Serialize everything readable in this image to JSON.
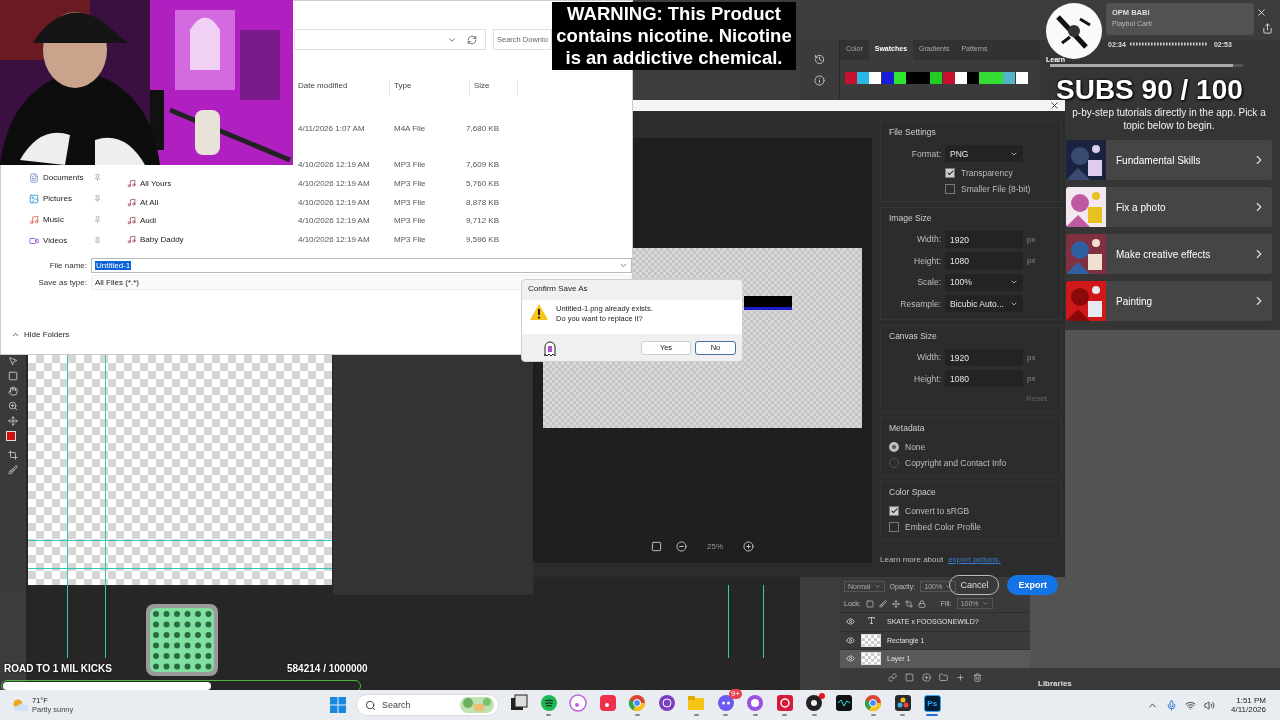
{
  "file_dialog": {
    "search_placeholder": "Search Downlo",
    "columns": [
      "Date modified",
      "Type",
      "Size"
    ],
    "files": [
      {
        "date": "4/11/2026 1:07 AM",
        "type": "M4A File",
        "size": "7,680 KB"
      },
      {
        "date": "4/10/2026 12:19 AM",
        "type": "MP3 File",
        "size": "7,609 KB"
      },
      {
        "name": "All Yours",
        "date": "4/10/2026 12:19 AM",
        "type": "MP3 File",
        "size": "5,760 KB"
      },
      {
        "name": "At All",
        "date": "4/10/2026 12:19 AM",
        "type": "MP3 File",
        "size": "8,878 KB"
      },
      {
        "name": "Audi",
        "date": "4/10/2026 12:19 AM",
        "type": "MP3 File",
        "size": "9,712 KB"
      },
      {
        "name": "Baby Daddy",
        "date": "4/10/2026 12:19 AM",
        "type": "MP3 File",
        "size": "9,596 KB"
      }
    ],
    "sidebar": [
      {
        "label": "Documents",
        "kind": "documents"
      },
      {
        "label": "Pictures",
        "kind": "pictures"
      },
      {
        "label": "Music",
        "kind": "music"
      },
      {
        "label": "Videos",
        "kind": "videos"
      }
    ],
    "file_name_label": "File name:",
    "file_name": "Untitled-1",
    "file_name_highlighted": true,
    "type_label": "Save as type:",
    "save_type": "All Files (*.*)",
    "hide_folders": "Hide Folders"
  },
  "warning": "WARNING: This Product contains nicotine. Nicotine is an addictive chemical.",
  "music": {
    "title": "OPM BABI",
    "artist": "Playboi Carti",
    "elapsed": "02:34",
    "total": "02:53",
    "level": 0.95
  },
  "swatches_panel": {
    "tabs": [
      {
        "label": "Color",
        "selected": false
      },
      {
        "label": "Swatches",
        "selected": true
      },
      {
        "label": "Gradients",
        "selected": false
      },
      {
        "label": "Patterns",
        "selected": false
      }
    ],
    "swatches": [
      {
        "color": "#c8102e"
      },
      {
        "color": "#27b8e6"
      },
      {
        "color": "#ffffff"
      },
      {
        "color": "#1a1adb"
      },
      {
        "color": "#2ee62e"
      },
      {
        "color": "#000000"
      },
      {
        "color": "#000000"
      },
      {
        "color": "#22cc22"
      },
      {
        "color": "#c8102e"
      },
      {
        "color": "#ffffff"
      },
      {
        "color": "#000000"
      },
      {
        "color": "#33dd33"
      },
      {
        "color": "#33dd33"
      },
      {
        "color": "#55b5c8"
      },
      {
        "color": "#ffffff"
      }
    ]
  },
  "learn": {
    "tab": "Learn",
    "subs": "SUBS 90 / 100",
    "intro": "p-by-step tutorials directly in the app. Pick a topic below to begin.",
    "topics": [
      {
        "title": "Fundamental Skills",
        "kind": "night"
      },
      {
        "title": "Fix a photo",
        "kind": "flowers"
      },
      {
        "title": "Make creative effects",
        "kind": "collage"
      },
      {
        "title": "Painting",
        "kind": "fish"
      }
    ]
  },
  "export_dialog": {
    "file_settings": {
      "heading": "File Settings",
      "format_label": "Format:",
      "format": "PNG",
      "options": [
        {
          "label": "Transparency",
          "checked": true
        },
        {
          "label": "Smaller File (8-bit)",
          "checked": false
        }
      ]
    },
    "image_size": {
      "heading": "Image Size",
      "fields": [
        {
          "label": "Width:",
          "value": "1920",
          "unit": "px",
          "kind": "input"
        },
        {
          "label": "Height:",
          "value": "1080",
          "unit": "px",
          "kind": "input"
        },
        {
          "label": "Scale:",
          "value": "100%",
          "kind": "select"
        },
        {
          "label": "Resample:",
          "value": "Bicubic Auto...",
          "kind": "select"
        }
      ]
    },
    "canvas_size": {
      "heading": "Canvas Size",
      "fields": [
        {
          "label": "Width:",
          "value": "1920",
          "unit": "px",
          "kind": "input"
        },
        {
          "label": "Height:",
          "value": "1080",
          "unit": "px",
          "kind": "input"
        }
      ],
      "reset": "Reset",
      "reset_disabled": true
    },
    "metadata": {
      "heading": "Metadata",
      "options": [
        {
          "label": "None",
          "selected": true
        },
        {
          "label": "Copyright and Contact Info",
          "selected": false
        }
      ]
    },
    "color_space": {
      "heading": "Color Space",
      "options": [
        {
          "label": "Convert to sRGB",
          "checked": true
        },
        {
          "label": "Embed Color Profile",
          "checked": false
        }
      ]
    },
    "learn_more": "Learn more about",
    "link": "export options.",
    "zoom": "25%",
    "cancel": "Cancel",
    "export": "Export"
  },
  "confirm": {
    "title": "Confirm Save As",
    "message": [
      "Untitled-1.png already exists.",
      "Do you want to replace it?"
    ],
    "buttons": [
      {
        "label": "Yes",
        "focused": false
      },
      {
        "label": "No",
        "focused": true
      }
    ]
  },
  "layers": {
    "blend": "Normal",
    "opacity_label": "Opacity:",
    "opacity": "100%",
    "lock_label": "Lock:",
    "fill_label": "Fill:",
    "fill": "100%",
    "items": [
      {
        "name": "SKATE x FOOSGONEWILD?",
        "kind": "text",
        "selected": false
      },
      {
        "name": "Rectangle 1",
        "kind": "shape",
        "selected": false
      },
      {
        "name": "Layer 1",
        "kind": "pixel",
        "selected": true
      }
    ],
    "libraries": "Libraries"
  },
  "kicks": {
    "label": "ROAD TO 1 MIL KICKS",
    "count": "584214 / 1000000",
    "level": 0.584
  },
  "taskbar": {
    "temp": "71°F",
    "condition": "Partly sunny",
    "search_placeholder": "Search",
    "apps": [
      {
        "kind": "switcher",
        "running": false,
        "active": false
      },
      {
        "kind": "spotify",
        "running": true,
        "active": false
      },
      {
        "kind": "itunes",
        "running": false,
        "active": false
      },
      {
        "kind": "applemusic",
        "running": false,
        "active": false
      },
      {
        "kind": "chrome",
        "running": true,
        "active": false
      },
      {
        "kind": "tor",
        "running": false,
        "active": false
      },
      {
        "kind": "explorer",
        "running": true,
        "active": false
      },
      {
        "kind": "discord",
        "running": true,
        "active": false,
        "badge": "9+"
      },
      {
        "kind": "ring",
        "running": true,
        "active": false
      },
      {
        "kind": "redapp",
        "running": true,
        "active": false
      },
      {
        "kind": "obs",
        "running": true,
        "active": false,
        "alert": true
      },
      {
        "kind": "wave",
        "running": false,
        "active": false
      },
      {
        "kind": "chrome",
        "running": true,
        "active": false
      },
      {
        "kind": "davinci",
        "running": true,
        "active": false
      },
      {
        "kind": "photoshop",
        "label": "Ps",
        "running": true,
        "active": true
      }
    ],
    "time": "1:51 PM",
    "date": "4/11/2026"
  }
}
